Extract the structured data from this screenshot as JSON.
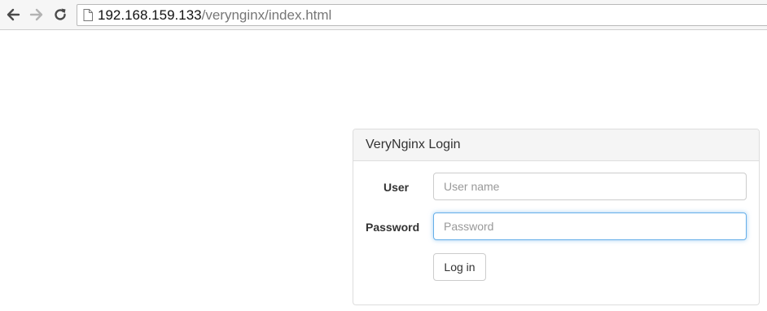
{
  "browser": {
    "url_host": "192.168.159.133",
    "url_path": "/verynginx/index.html",
    "back_icon": "arrow-left-icon",
    "forward_icon": "arrow-right-icon",
    "reload_icon": "reload-icon",
    "page_icon": "document-icon"
  },
  "login_panel": {
    "title": "VeryNginx Login",
    "user_label": "User",
    "user_placeholder": "User name",
    "user_value": "",
    "password_label": "Password",
    "password_placeholder": "Password",
    "password_value": "",
    "submit_label": "Log in"
  },
  "colors": {
    "focus_border": "#66afe9",
    "panel_heading_bg": "#f5f5f5",
    "panel_border": "#dddddd"
  }
}
